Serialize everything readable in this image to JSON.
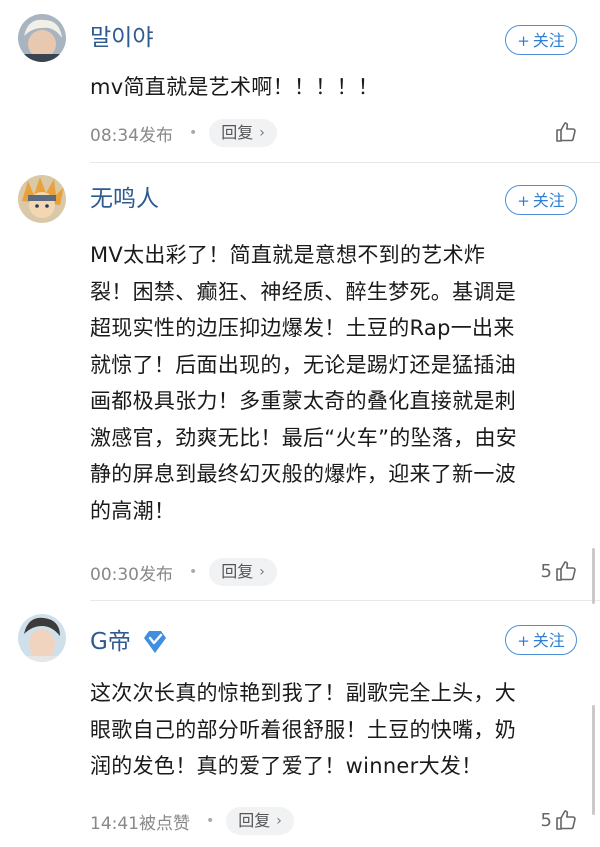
{
  "follow_label": "关注",
  "comments": [
    {
      "username": "말이야",
      "text": "mv简直就是艺术啊！！！！！",
      "time": "08:34发布",
      "reply_label": "回复",
      "likes": ""
    },
    {
      "username": "无鸣人",
      "text": "MV太出彩了！简直就是意想不到的艺术炸\n裂！困禁、癫狂、神经质、醉生梦死。基调是\n超现实性的边压抑边爆发！土豆的Rap一出来\n就惊了！后面出现的，无论是踢灯还是猛插油\n画都极具张力！多重蒙太奇的叠化直接就是刺\n激感官，劲爽无比！最后“火车”的坠落，由安\n静的屏息到最终幻灭般的爆炸，迎来了新一波\n的高潮！",
      "time": "00:30发布",
      "reply_label": "回复",
      "likes": "5"
    },
    {
      "username": "G帝",
      "text": "这次次长真的惊艳到我了！副歌完全上头，大\n眼歌自己的部分听着很舒服！土豆的快嘴，奶\n润的发色！真的爱了爱了！winner大发！",
      "time": "14:41被点赞",
      "reply_label": "回复",
      "likes": "5"
    }
  ]
}
